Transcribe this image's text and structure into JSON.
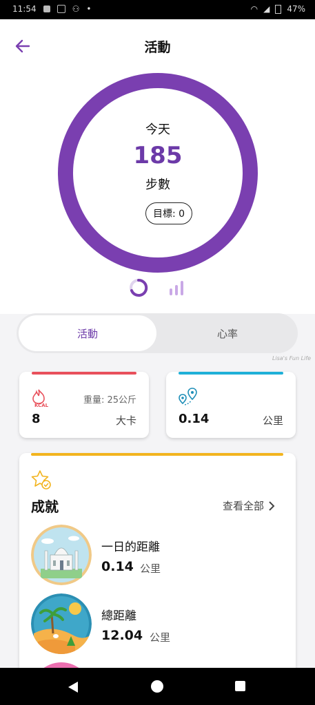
{
  "status_bar": {
    "time": "11:54",
    "battery": "47%"
  },
  "header": {
    "title": "活動"
  },
  "ring": {
    "label_top": "今天",
    "steps": "185",
    "steps_unit": "步數",
    "goal": "目標: 0",
    "progress_fraction": 1.0,
    "color": "#7a3fb0"
  },
  "tabs": {
    "active": "活動",
    "inactive": "心率"
  },
  "calories_card": {
    "icon": "kcal-flame-icon",
    "sub_label": "重量: 25公斤",
    "value": "8",
    "unit": "大卡",
    "accent": "#e8505b"
  },
  "distance_card": {
    "icon": "location-pins-icon",
    "value": "0.14",
    "unit": "公里",
    "accent": "#1fb0d8"
  },
  "watermark": "Lisa's Fun Life",
  "achievements": {
    "title": "成就",
    "view_all": "查看全部",
    "accent": "#f2b41e",
    "items": [
      {
        "name": "一日的距離",
        "value": "0.14",
        "unit": "公里"
      },
      {
        "name": "總距離",
        "value": "12.04",
        "unit": "公里"
      }
    ]
  }
}
